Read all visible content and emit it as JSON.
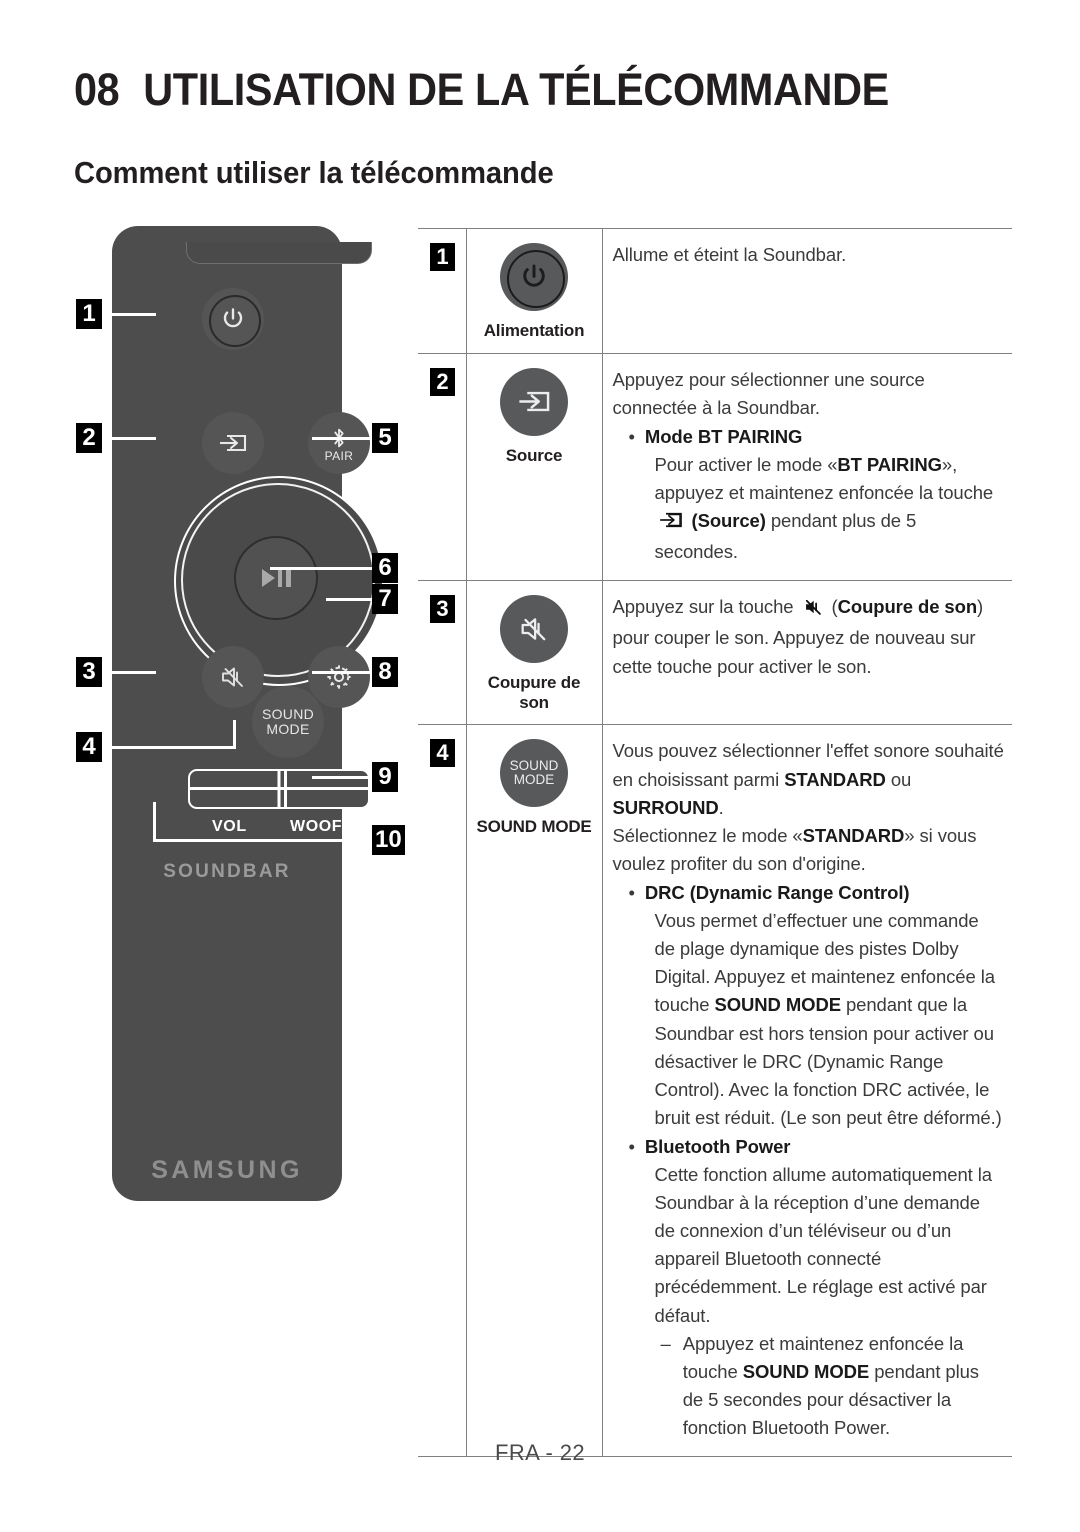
{
  "header": {
    "chapter_number": "08",
    "chapter_title": "UTILISATION DE LA TÉLÉCOMMANDE",
    "section_title": "Comment utiliser la télécommande"
  },
  "remote": {
    "pair_label": "PAIR",
    "sound_mode_line1": "SOUND",
    "sound_mode_line2": "MODE",
    "vol_label": "VOL",
    "woofer_label": "WOOFER",
    "soundbar_label": "SOUNDBAR",
    "brand_label": "SAMSUNG",
    "callouts": [
      "1",
      "2",
      "3",
      "4",
      "5",
      "6",
      "7",
      "8",
      "9",
      "10"
    ]
  },
  "table": {
    "rows": [
      {
        "number": "1",
        "icon": "power-icon",
        "icon_label": "Alimentation",
        "paragraphs": [
          {
            "type": "plain",
            "text": "Allume et éteint la Soundbar."
          }
        ]
      },
      {
        "number": "2",
        "icon": "source-icon",
        "icon_label": "Source",
        "paragraphs": [
          {
            "type": "plain",
            "text": "Appuyez pour sélectionner une source connectée à la Soundbar."
          },
          {
            "type": "bullet",
            "bold": "Mode BT PAIRING"
          },
          {
            "type": "indent",
            "segments": [
              {
                "t": "Pour activer le mode «",
                "b": false
              },
              {
                "t": "BT PAIRING",
                "b": true
              },
              {
                "t": "», appuyez et maintenez enfoncée la touche ",
                "b": false
              },
              {
                "t": "__SOURCE_ICON__",
                "b": false
              },
              {
                "t": " (Source)",
                "b": true
              },
              {
                "t": " pendant plus de 5 secondes.",
                "b": false
              }
            ]
          }
        ]
      },
      {
        "number": "3",
        "icon": "mute-icon",
        "icon_label": "Coupure de son",
        "paragraphs": [
          {
            "type": "segments",
            "segments": [
              {
                "t": "Appuyez sur la touche ",
                "b": false
              },
              {
                "t": "__MUTE_ICON__",
                "b": false
              },
              {
                "t": " (",
                "b": false
              },
              {
                "t": "Coupure de son",
                "b": true
              },
              {
                "t": ") pour couper le son.  Appuyez de nouveau sur cette touche pour activer le son.",
                "b": false
              }
            ]
          }
        ]
      },
      {
        "number": "4",
        "icon": "sound-mode-icon",
        "icon_label": "SOUND MODE",
        "icon_label_line1": "SOUND",
        "icon_label_line2": "MODE",
        "paragraphs": [
          {
            "type": "segments",
            "segments": [
              {
                "t": "Vous pouvez sélectionner l'effet sonore souhaité en choisissant parmi ",
                "b": false
              },
              {
                "t": "STANDARD",
                "b": true
              },
              {
                "t": " ou ",
                "b": false
              },
              {
                "t": "SURROUND",
                "b": true
              },
              {
                "t": ".",
                "b": false
              }
            ]
          },
          {
            "type": "segments",
            "segments": [
              {
                "t": "Sélectionnez le mode «",
                "b": false
              },
              {
                "t": "STANDARD",
                "b": true
              },
              {
                "t": "» si vous voulez profiter du son d'origine.",
                "b": false
              }
            ]
          },
          {
            "type": "bullet",
            "bold": "DRC (Dynamic Range Control)"
          },
          {
            "type": "indent",
            "segments": [
              {
                "t": "Vous permet d’effectuer une commande de plage dynamique des pistes Dolby Digital. Appuyez et maintenez enfoncée la touche ",
                "b": false
              },
              {
                "t": "SOUND MODE",
                "b": true
              },
              {
                "t": " pendant que la Soundbar est hors tension pour activer ou désactiver le DRC (Dynamic Range Control). Avec la fonction DRC activée, le bruit est réduit. (Le son peut être déformé.)",
                "b": false
              }
            ]
          },
          {
            "type": "bullet",
            "bold": "Bluetooth Power"
          },
          {
            "type": "indent",
            "segments": [
              {
                "t": "Cette fonction allume automatiquement la Soundbar à la réception d’une demande de connexion d’un téléviseur ou d’un appareil Bluetooth connecté précédemment. Le réglage est activé par défaut.",
                "b": false
              }
            ]
          },
          {
            "type": "dash",
            "segments": [
              {
                "t": "Appuyez et maintenez enfoncée la touche ",
                "b": false
              },
              {
                "t": "SOUND MODE",
                "b": true
              },
              {
                "t": " pendant plus de 5 secondes pour désactiver la fonction Bluetooth Power.",
                "b": false
              }
            ]
          }
        ]
      }
    ]
  },
  "footer": {
    "page_label": "FRA - 22"
  },
  "colors": {
    "remote_body": "#4d4d4d",
    "button_fill": "#555555",
    "table_button_fill": "#58595b",
    "rule": "#808080",
    "body_text": "#3b3b3b"
  }
}
